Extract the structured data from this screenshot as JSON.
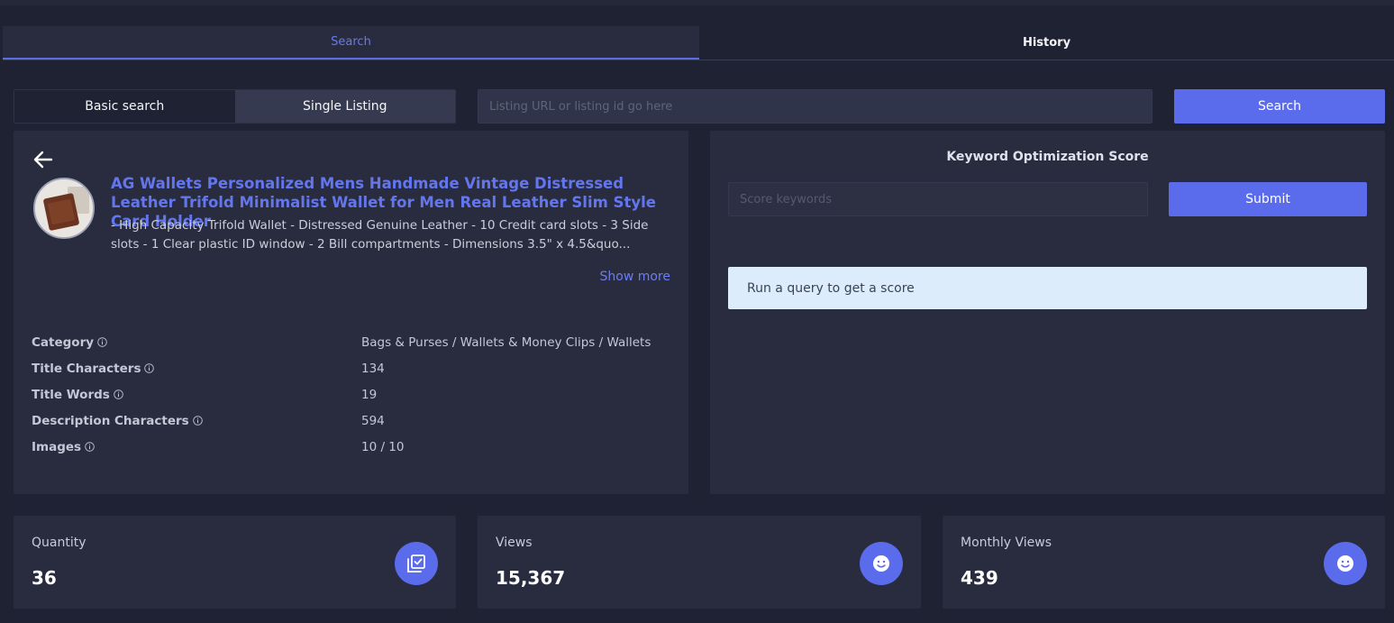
{
  "tabs": {
    "search": "Search",
    "history": "History"
  },
  "search_mode": {
    "basic": "Basic search",
    "single": "Single Listing"
  },
  "url_input": {
    "placeholder": "Listing URL or listing id go here",
    "value": ""
  },
  "search_button": "Search",
  "listing": {
    "title": "AG Wallets Personalized Mens Handmade Vintage Distressed Leather Trifold Minimalist Wallet for Men Real Leather Slim Style Card Holder",
    "description": "- High Capacity Trifold Wallet - Distressed Genuine Leather - 10 Credit card slots - 3 Side slots - 1 Clear plastic ID window - 2 Bill compartments - Dimensions 3.5\" x 4.5&quo...",
    "show_more": "Show more"
  },
  "stats": [
    {
      "label": "Category",
      "value": "Bags & Purses / Wallets & Money Clips / Wallets"
    },
    {
      "label": "Title Characters",
      "value": "134"
    },
    {
      "label": "Title Words",
      "value": "19"
    },
    {
      "label": "Description Characters",
      "value": "594"
    },
    {
      "label": "Images",
      "value": "10 / 10"
    }
  ],
  "keyword_score": {
    "title": "Keyword Optimization Score",
    "placeholder": "Score keywords",
    "submit": "Submit",
    "message": "Run a query to get a score"
  },
  "metrics": [
    {
      "label": "Quantity",
      "value": "36",
      "icon": "checkbox-stack-icon"
    },
    {
      "label": "Views",
      "value": "15,367",
      "icon": "smiley-icon"
    },
    {
      "label": "Monthly Views",
      "value": "439",
      "icon": "smiley-icon"
    }
  ],
  "colors": {
    "background": "#1f2232",
    "panel": "#292c3f",
    "accent": "#5a6cec",
    "link": "#6376ee",
    "alert": "#dcecfa"
  }
}
